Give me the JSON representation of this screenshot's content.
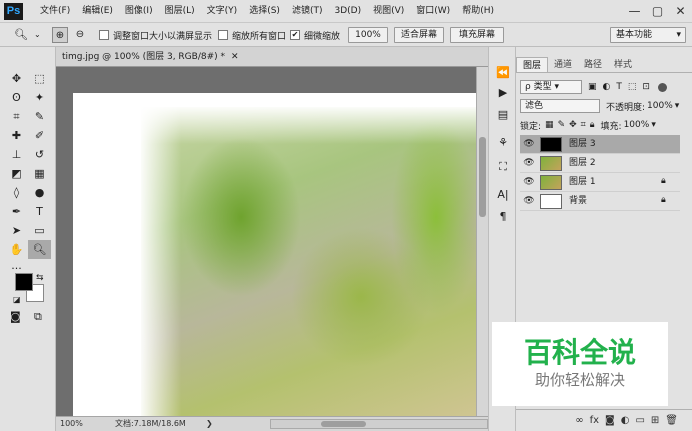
{
  "app": {
    "logo": "Ps"
  },
  "menu": [
    "文件(F)",
    "编辑(E)",
    "图像(I)",
    "图层(L)",
    "文字(Y)",
    "选择(S)",
    "滤镜(T)",
    "3D(D)",
    "视图(V)",
    "窗口(W)",
    "帮助(H)"
  ],
  "window_controls": {
    "minimize": "—",
    "maximize": "▢",
    "close": "✕"
  },
  "options": {
    "resize_windows_label": "调整窗口大小以满屏显示",
    "zoom_all_label": "缩放所有窗口",
    "scrubby_zoom_label": "细微缩放",
    "scrubby_zoom_checked": true,
    "zoom_value": "100%",
    "fit_screen": "适合屏幕",
    "fill_screen": "填充屏幕",
    "workspace": "基本功能"
  },
  "document": {
    "tab_title": "timg.jpg @ 100% (图层 3, RGB/8#) *",
    "zoom": "100%",
    "doc_size": "文档:7.18M/18.6M"
  },
  "panel": {
    "tabs": [
      "图层",
      "通道",
      "路径",
      "样式"
    ],
    "active_tab": "图层",
    "filter_kind": "ρ 类型",
    "blend_mode": "滤色",
    "opacity_label": "不透明度:",
    "opacity_value": "100%",
    "lock_label": "锁定:",
    "fill_label": "填充:",
    "fill_value": "100%",
    "layers": [
      {
        "name": "图层 3",
        "thumb": "black",
        "locked": false,
        "selected": true
      },
      {
        "name": "图层 2",
        "thumb": "photo",
        "locked": false,
        "selected": false
      },
      {
        "name": "图层 1",
        "thumb": "photo",
        "locked": true,
        "selected": false
      },
      {
        "name": "背景",
        "thumb": "white",
        "locked": true,
        "selected": false
      }
    ],
    "bottom_icons": [
      "link-icon",
      "fx-icon",
      "mask-icon",
      "adjustment-icon",
      "group-icon",
      "new-layer-icon",
      "trash-icon"
    ]
  },
  "watermark": {
    "title": "百科全说",
    "subtitle": "助你轻松解决"
  },
  "colors": {
    "accent": "#31a8ff",
    "watermark_green": "#22b14c",
    "ui_bg": "#e2e2e2",
    "workspace_bg": "#6e6e6e"
  }
}
